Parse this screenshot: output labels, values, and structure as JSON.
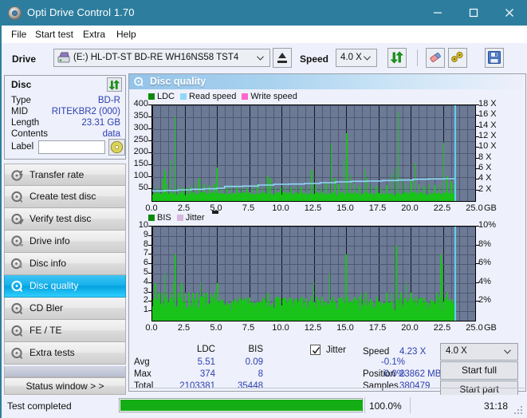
{
  "window": {
    "title": "Opti Drive Control 1.70",
    "icon": "disc-icon",
    "minimize": "minimize-icon",
    "maximize": "maximize-icon",
    "close": "close-icon",
    "accent_color": "#2d7e9e"
  },
  "menu": {
    "items": [
      "File",
      "Start test",
      "Extra",
      "Help"
    ]
  },
  "toolbar": {
    "drive_label": "Drive",
    "drive_value": "(E:)  HL-DT-ST BD-RE  WH16NS58 TST4",
    "eject_label": "eject-icon",
    "speed_label": "Speed",
    "speed_value": "4.0 X",
    "refresh_icon": "refresh-icon",
    "erase_icon": "eraser-icon",
    "tools_icon": "tools-icon",
    "save_icon": "save-icon"
  },
  "disc": {
    "header": "Disc",
    "refresh_icon": "refresh-icon",
    "rows": [
      {
        "key": "Type",
        "value": "BD-R"
      },
      {
        "key": "MID",
        "value": "RITEKBR2 (000)"
      },
      {
        "key": "Length",
        "value": "23.31 GB"
      },
      {
        "key": "Contents",
        "value": "data"
      }
    ],
    "label_key": "Label",
    "label_value": "",
    "label_placeholder": "",
    "label_button_icon": "cd-icon"
  },
  "nav": {
    "items": [
      {
        "label": "Transfer rate",
        "active": false
      },
      {
        "label": "Create test disc",
        "active": false
      },
      {
        "label": "Verify test disc",
        "active": false
      },
      {
        "label": "Drive info",
        "active": false
      },
      {
        "label": "Disc info",
        "active": false
      },
      {
        "label": "Disc quality",
        "active": true
      },
      {
        "label": "CD Bler",
        "active": false
      },
      {
        "label": "FE / TE",
        "active": false
      },
      {
        "label": "Extra tests",
        "active": false
      }
    ],
    "status_window": "Status window > >"
  },
  "panel": {
    "title": "Disc quality",
    "icon": "disc-quality-icon"
  },
  "chart_data": [
    {
      "type": "line",
      "title": "LDC / Read speed",
      "legend": [
        {
          "label": "LDC",
          "color": "#0c8a0c"
        },
        {
          "label": "Read speed",
          "color": "#8fd8f7"
        },
        {
          "label": "Write speed",
          "color": "#ff66cc"
        }
      ],
      "legend_position": "top-left",
      "xlabel": "GB",
      "xlim": [
        0.0,
        25.0
      ],
      "xticks": [
        "0.0",
        "2.5",
        "5.0",
        "7.5",
        "10.0",
        "12.5",
        "15.0",
        "17.5",
        "20.0",
        "22.5",
        "25.0"
      ],
      "ylabel_left": "LDC",
      "ylim": [
        0,
        400
      ],
      "yticks": [
        50,
        100,
        150,
        200,
        250,
        300,
        350,
        400
      ],
      "ylabel_right": "Speed",
      "ylim_right": [
        0,
        18
      ],
      "yticks_right": [
        "2 X",
        "4 X",
        "6 X",
        "8 X",
        "10 X",
        "12 X",
        "14 X",
        "16 X",
        "18 X"
      ],
      "grid": true,
      "plot_bg": "#6c7a96",
      "data_end_gb": 23.4,
      "series": [
        {
          "name": "LDC",
          "color": "#19c319",
          "kind": "spikes",
          "baseline": 22,
          "noise": 16,
          "peaks": [
            [
              0.35,
              60
            ],
            [
              0.55,
              48
            ],
            [
              0.8,
              95
            ],
            [
              0.95,
              130
            ],
            [
              1.1,
              72
            ],
            [
              1.35,
              175
            ],
            [
              1.7,
              352
            ],
            [
              1.95,
              66
            ],
            [
              2.3,
              58
            ],
            [
              2.6,
              52
            ],
            [
              2.9,
              60
            ],
            [
              3.3,
              78
            ],
            [
              3.6,
              96
            ],
            [
              3.95,
              70
            ],
            [
              4.4,
              62
            ],
            [
              4.75,
              74
            ],
            [
              4.95,
              140
            ],
            [
              5.3,
              60
            ],
            [
              5.7,
              55
            ],
            [
              6.1,
              66
            ],
            [
              6.5,
              58
            ],
            [
              6.9,
              62
            ],
            [
              7.3,
              54
            ],
            [
              7.7,
              60
            ],
            [
              8.1,
              70
            ],
            [
              8.5,
              58
            ],
            [
              8.9,
              105
            ],
            [
              9.1,
              92
            ],
            [
              9.5,
              60
            ],
            [
              9.9,
              56
            ],
            [
              10.3,
              62
            ],
            [
              10.7,
              58
            ],
            [
              11.1,
              64
            ],
            [
              11.5,
              60
            ],
            [
              11.9,
              58
            ],
            [
              12.3,
              130
            ],
            [
              12.6,
              66
            ],
            [
              13.0,
              58
            ],
            [
              13.4,
              72
            ],
            [
              13.8,
              238
            ],
            [
              14.1,
              96
            ],
            [
              14.4,
              70
            ],
            [
              14.8,
              170
            ],
            [
              15.0,
              282
            ],
            [
              15.3,
              110
            ],
            [
              15.6,
              74
            ],
            [
              16.0,
              64
            ],
            [
              16.4,
              132
            ],
            [
              16.6,
              96
            ],
            [
              16.9,
              70
            ],
            [
              17.3,
              62
            ],
            [
              17.7,
              58
            ],
            [
              18.1,
              66
            ],
            [
              18.5,
              112
            ],
            [
              18.8,
              140
            ],
            [
              19.0,
              372
            ],
            [
              19.3,
              96
            ],
            [
              19.6,
              72
            ],
            [
              20.0,
              88
            ],
            [
              20.3,
              160
            ],
            [
              20.6,
              70
            ],
            [
              21.0,
              64
            ],
            [
              21.4,
              72
            ],
            [
              21.8,
              66
            ],
            [
              22.2,
              70
            ],
            [
              22.5,
              242
            ],
            [
              22.8,
              104
            ],
            [
              23.1,
              84
            ],
            [
              23.3,
              70
            ]
          ]
        },
        {
          "name": "Read speed",
          "color": "#8fd8f7",
          "kind": "step",
          "points": [
            [
              0.0,
              1.9
            ],
            [
              1.0,
              2.0
            ],
            [
              2.0,
              2.1
            ],
            [
              3.0,
              2.2
            ],
            [
              4.0,
              2.3
            ],
            [
              5.0,
              2.4
            ],
            [
              5.6,
              2.75
            ],
            [
              7.0,
              2.8
            ],
            [
              8.2,
              3.0
            ],
            [
              9.4,
              3.15
            ],
            [
              10.6,
              3.2
            ],
            [
              11.8,
              3.3
            ],
            [
              13.0,
              3.45
            ],
            [
              14.2,
              3.6
            ],
            [
              15.4,
              3.7
            ],
            [
              16.6,
              3.75
            ],
            [
              17.8,
              3.85
            ],
            [
              19.0,
              3.95
            ],
            [
              20.2,
              4.1
            ],
            [
              21.4,
              4.15
            ],
            [
              22.6,
              4.2
            ],
            [
              23.35,
              4.25
            ]
          ]
        },
        {
          "name": "End marker",
          "color": "#5fd0f5",
          "kind": "vline",
          "x": 23.4
        }
      ]
    },
    {
      "type": "line",
      "title": "BIS / Jitter",
      "legend": [
        {
          "label": "BIS",
          "color": "#0c8a0c"
        },
        {
          "label": "Jitter",
          "color": "#d9b6e0"
        }
      ],
      "legend_position": "top-left",
      "xlabel": "GB",
      "xlim": [
        0.0,
        25.0
      ],
      "xticks": [
        "0.0",
        "2.5",
        "5.0",
        "7.5",
        "10.0",
        "12.5",
        "15.0",
        "17.5",
        "20.0",
        "22.5",
        "25.0"
      ],
      "ylabel_left": "BIS",
      "ylim": [
        0,
        10
      ],
      "yticks": [
        1,
        2,
        3,
        4,
        5,
        6,
        7,
        8,
        9,
        10
      ],
      "ylabel_right": "Jitter",
      "ylim_right": [
        0,
        10
      ],
      "yticks_right": [
        "2%",
        "4%",
        "6%",
        "8%",
        "10%"
      ],
      "grid": true,
      "plot_bg": "#6c7a96",
      "data_end_gb": 23.4,
      "series": [
        {
          "name": "BIS",
          "color": "#19c319",
          "kind": "spikes",
          "baseline": 1.0,
          "noise": 1.6,
          "peaks": [
            [
              0.2,
              4.0
            ],
            [
              0.45,
              3.0
            ],
            [
              0.7,
              3.0
            ],
            [
              0.9,
              5.0
            ],
            [
              1.1,
              3.0
            ],
            [
              1.35,
              3.0
            ],
            [
              1.6,
              4.0
            ],
            [
              1.75,
              7.0
            ],
            [
              2.0,
              3.0
            ],
            [
              2.25,
              4.0
            ],
            [
              2.5,
              3.0
            ],
            [
              2.8,
              3.0
            ],
            [
              3.1,
              3.0
            ],
            [
              3.4,
              3.0
            ],
            [
              3.7,
              4.0
            ],
            [
              3.95,
              3.0
            ],
            [
              4.2,
              3.0
            ],
            [
              4.5,
              3.0
            ],
            [
              4.75,
              3.0
            ],
            [
              5.0,
              4.0
            ],
            [
              5.3,
              2.0
            ],
            [
              5.7,
              2.0
            ],
            [
              6.1,
              2.0
            ],
            [
              6.5,
              2.0
            ],
            [
              6.9,
              2.0
            ],
            [
              7.3,
              2.0
            ],
            [
              7.7,
              2.0
            ],
            [
              8.1,
              2.0
            ],
            [
              8.5,
              2.0
            ],
            [
              8.9,
              3.0
            ],
            [
              9.3,
              2.0
            ],
            [
              9.7,
              2.0
            ],
            [
              10.1,
              2.0
            ],
            [
              10.5,
              2.0
            ],
            [
              10.9,
              2.0
            ],
            [
              11.3,
              2.0
            ],
            [
              11.7,
              2.0
            ],
            [
              12.1,
              2.0
            ],
            [
              12.45,
              4.0
            ],
            [
              12.9,
              2.0
            ],
            [
              13.3,
              2.0
            ],
            [
              13.7,
              5.0
            ],
            [
              14.1,
              2.0
            ],
            [
              14.5,
              2.0
            ],
            [
              14.95,
              7.0
            ],
            [
              15.3,
              2.0
            ],
            [
              15.7,
              2.0
            ],
            [
              16.1,
              3.0
            ],
            [
              16.5,
              3.0
            ],
            [
              16.9,
              2.0
            ],
            [
              17.3,
              2.0
            ],
            [
              17.7,
              2.0
            ],
            [
              18.1,
              3.0
            ],
            [
              18.5,
              3.0
            ],
            [
              18.85,
              8.0
            ],
            [
              19.2,
              3.0
            ],
            [
              19.6,
              4.0
            ],
            [
              20.0,
              3.0
            ],
            [
              20.4,
              2.0
            ],
            [
              20.8,
              2.0
            ],
            [
              21.2,
              2.0
            ],
            [
              21.6,
              2.0
            ],
            [
              22.0,
              3.0
            ],
            [
              22.3,
              7.0
            ],
            [
              22.45,
              6.0
            ],
            [
              22.8,
              3.0
            ],
            [
              23.1,
              2.0
            ],
            [
              23.3,
              2.0
            ]
          ]
        },
        {
          "name": "End marker",
          "color": "#5fd0f5",
          "kind": "vline",
          "x": 23.4
        }
      ]
    }
  ],
  "stats": {
    "col_headers": [
      "LDC",
      "BIS"
    ],
    "rows": [
      {
        "label": "Avg",
        "ldc": "5.51",
        "bis": "0.09",
        "jitter": "-0.1%"
      },
      {
        "label": "Max",
        "ldc": "374",
        "bis": "8",
        "jitter": "0.0%"
      },
      {
        "label": "Total",
        "ldc": "2103381",
        "bis": "35448",
        "jitter": ""
      }
    ],
    "jitter_label": "Jitter",
    "jitter_checked": true,
    "speed_label": "Speed",
    "speed_value": "4.23 X",
    "position_label": "Position",
    "position_value": "23862 MB",
    "samples_label": "Samples",
    "samples_value": "380479",
    "speed_select": "4.0 X",
    "start_full": "Start full",
    "start_part": "Start part"
  },
  "statusbar": {
    "text": "Test completed",
    "progress_pct": 100.0,
    "progress_label": "100.0%",
    "elapsed": "31:18",
    "progress_color": "#15ad15"
  }
}
